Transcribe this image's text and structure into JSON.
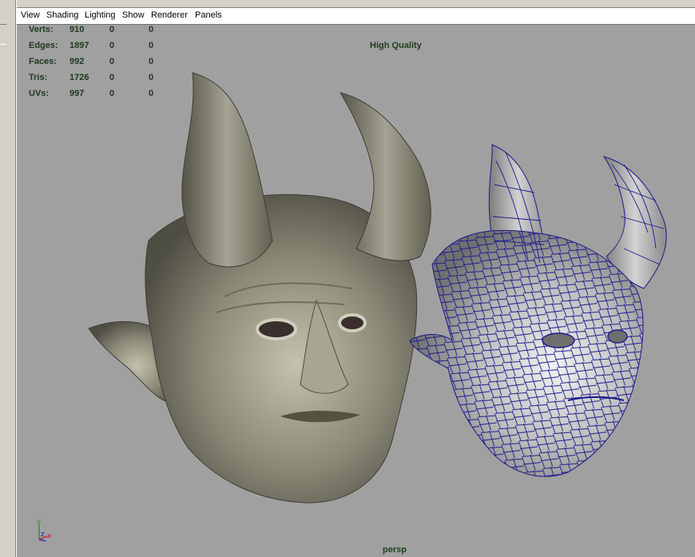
{
  "menu": {
    "view": "View",
    "shading": "Shading",
    "lighting": "Lighting",
    "show": "Show",
    "renderer": "Renderer",
    "panels": "Panels"
  },
  "hud": {
    "rows": [
      {
        "label": "Verts:",
        "v1": "910",
        "v2": "0",
        "v3": "0"
      },
      {
        "label": "Edges:",
        "v1": "1897",
        "v2": "0",
        "v3": "0"
      },
      {
        "label": "Faces:",
        "v1": "992",
        "v2": "0",
        "v3": "0"
      },
      {
        "label": "Tris:",
        "v1": "1726",
        "v2": "0",
        "v3": "0"
      },
      {
        "label": "UVs:",
        "v1": "997",
        "v2": "0",
        "v3": "0"
      }
    ]
  },
  "quality_label": "High Quality",
  "camera_label": "persp",
  "axis": {
    "y": "y",
    "z": "z",
    "x": "x"
  },
  "colors": {
    "viewport_bg": "#a0a0a0",
    "hud_text": "#203a20",
    "wire": "#1a1a8c",
    "axis_x": "#c81e1e",
    "axis_y": "#1e9a1e",
    "axis_z": "#1e1ec8"
  }
}
